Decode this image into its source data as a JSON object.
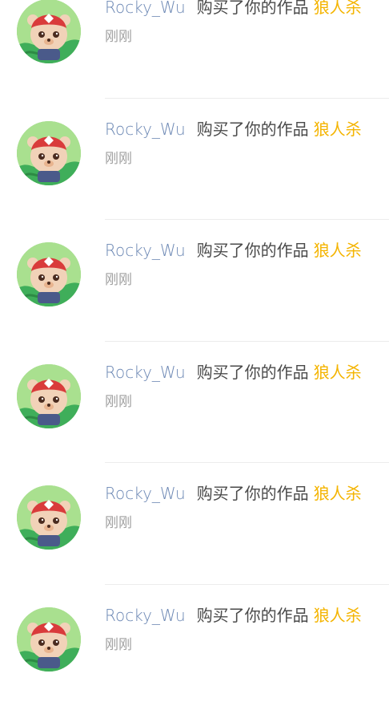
{
  "notifications": [
    {
      "user": "Rocky_Wu",
      "action": "购买了你的作品",
      "work": "狼人杀",
      "time": "刚刚"
    },
    {
      "user": "Rocky_Wu",
      "action": "购买了你的作品",
      "work": "狼人杀",
      "time": "刚刚"
    },
    {
      "user": "Rocky_Wu",
      "action": "购买了你的作品",
      "work": "狼人杀",
      "time": "刚刚"
    },
    {
      "user": "Rocky_Wu",
      "action": "购买了你的作品",
      "work": "狼人杀",
      "time": "刚刚"
    },
    {
      "user": "Rocky_Wu",
      "action": "购买了你的作品",
      "work": "狼人杀",
      "time": "刚刚"
    },
    {
      "user": "Rocky_Wu",
      "action": "购买了你的作品",
      "work": "狼人杀",
      "time": "刚刚"
    }
  ],
  "colors": {
    "username": "#6a86b3",
    "action": "#4a4a4a",
    "work_title": "#f4b400",
    "timestamp": "#a0a0a0",
    "divider": "#ececec"
  },
  "icons": {
    "avatar": "bear-avatar-icon"
  }
}
